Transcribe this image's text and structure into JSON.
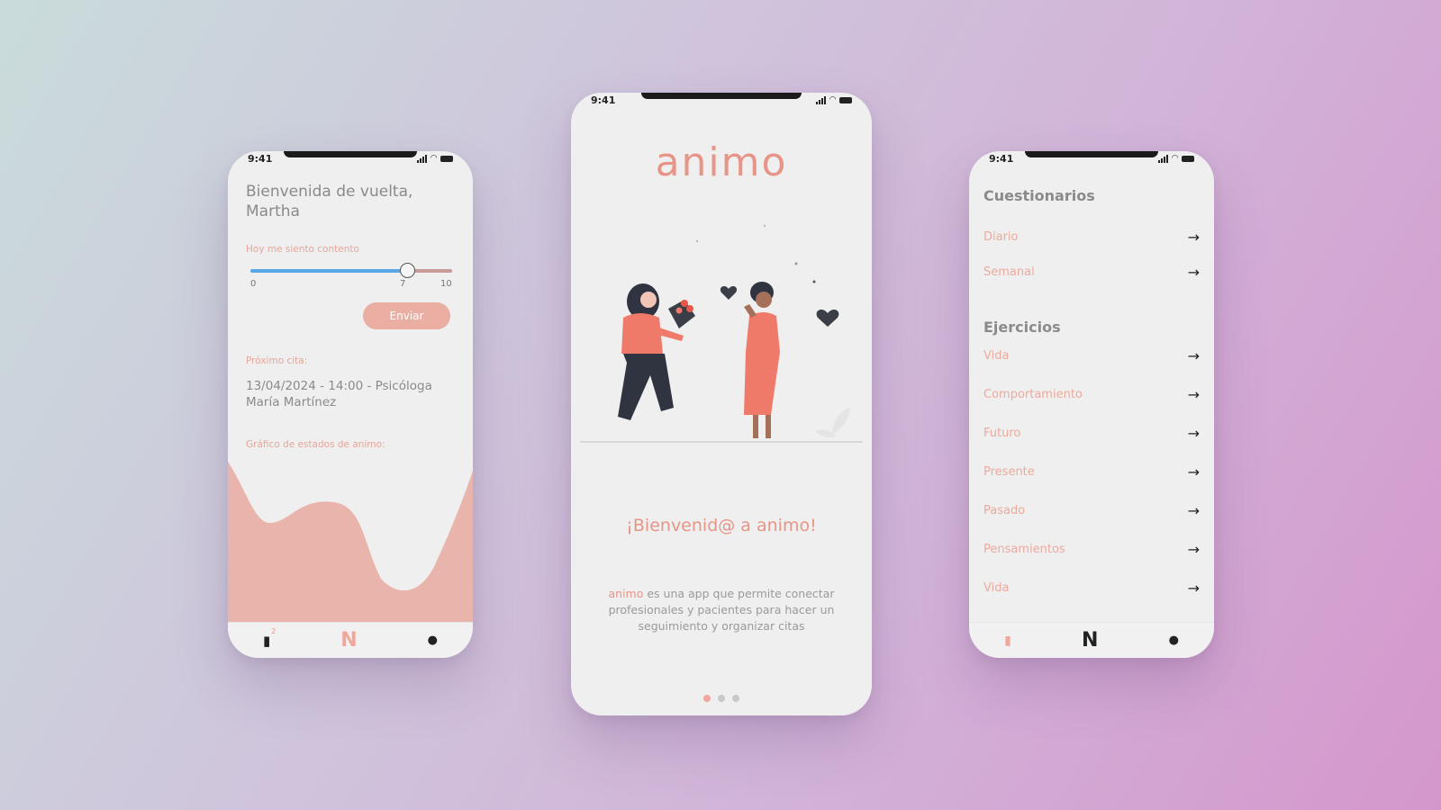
{
  "colors": {
    "accent": "#e69588",
    "button": "#eaaea3",
    "chart_fill": "#e8b4ab",
    "slider_fill": "#5aa7e6"
  },
  "left": {
    "status_time": "9:41",
    "greeting": "Bienvenida de vuelta, Martha",
    "slider": {
      "label": "Hoy me siento contento",
      "min": "0",
      "max": "10",
      "value": 7,
      "value_label": "7"
    },
    "send_label": "Enviar",
    "appointment_label": "Próximo cita:",
    "appointment_text": "13/04/2024 - 14:00 - Psicóloga María Martínez",
    "chart_label": "Gráfico de estados de animo:",
    "nav": {
      "badge": "2",
      "n_logo": "N",
      "notif_icon": "bell-icon",
      "profile_icon": "person-icon"
    }
  },
  "center": {
    "status_time": "9:41",
    "brand": "animo",
    "welcome": "¡Bienvenid@ a animo!",
    "desc_highlight": "animo",
    "desc_rest": " es una app que permite conectar profesionales y pacientes para hacer un seguimiento y organizar citas",
    "pager": {
      "count": 3,
      "active": 1
    }
  },
  "right": {
    "status_time": "9:41",
    "questionnaires_title": "Cuestionarios",
    "questionnaires": [
      "Diario",
      "Semanal"
    ],
    "exercises_title": "Ejercicios",
    "exercises": [
      "Vida",
      "Comportamiento",
      "Futuro",
      "Presente",
      "Pasado",
      "Pensamientos",
      "Vida"
    ],
    "nav": {
      "n_logo": "N",
      "hand_icon": "hand-icon",
      "profile_icon": "person-icon"
    }
  }
}
